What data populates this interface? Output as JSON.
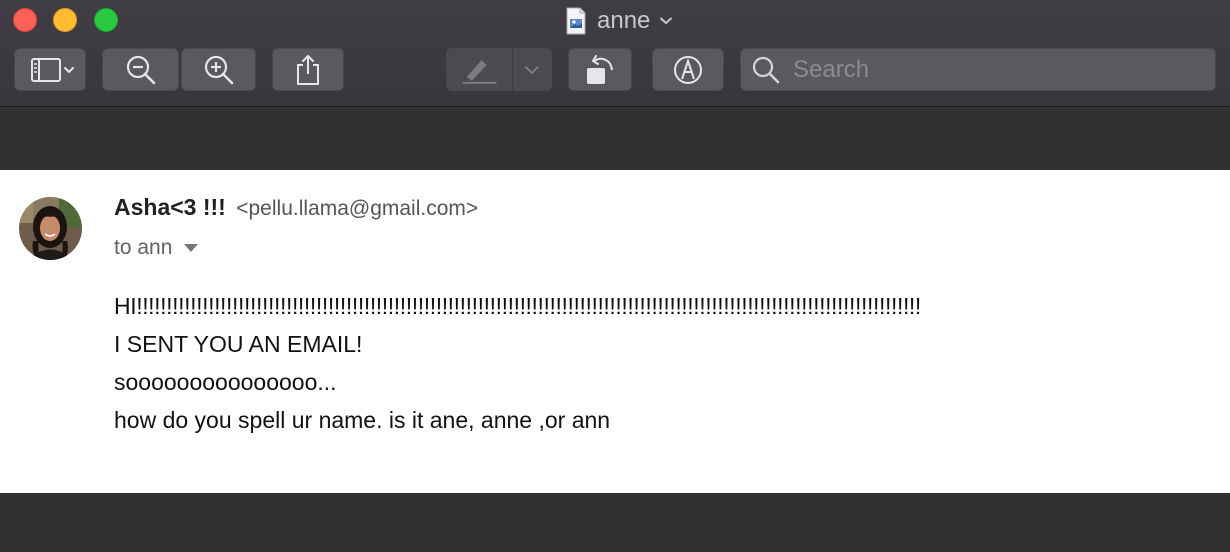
{
  "window": {
    "title": "anne",
    "doc_icon": "preview-document-icon",
    "title_chevron": "chevron-down-icon"
  },
  "toolbar": {
    "sidebar_button_icon": "sidebar-icon",
    "zoom_out_icon": "zoom-out-icon",
    "zoom_in_icon": "zoom-in-icon",
    "share_icon": "share-icon",
    "highlight_icon": "highlighter-icon",
    "rotate_icon": "rotate-left-icon",
    "markup_icon": "markup-pen-icon"
  },
  "search": {
    "placeholder": "Search",
    "value": ""
  },
  "email": {
    "sender_name": "Asha<3 !!!",
    "sender_email": "<pellu.llama@gmail.com>",
    "to_text": "to ann",
    "body_lines": [
      "HI!!!!!!!!!!!!!!!!!!!!!!!!!!!!!!!!!!!!!!!!!!!!!!!!!!!!!!!!!!!!!!!!!!!!!!!!!!!!!!!!!!!!!!!!!!!!!!!!!!!!!!!!!!!!!!!!!!!!!!!!!!!!!!!!!!!",
      "I SENT YOU AN EMAIL!",
      "sooooooooooooooo...",
      "how do you spell ur name. is it ane, anne ,or ann"
    ]
  },
  "colors": {
    "toolbar_bg": "#3c3a40",
    "button_bg": "#5b5960",
    "close": "#fe5f57",
    "minimize": "#febc2e",
    "maximize": "#28c840",
    "page_bg": "#ffffff",
    "window_bg": "#303030"
  }
}
